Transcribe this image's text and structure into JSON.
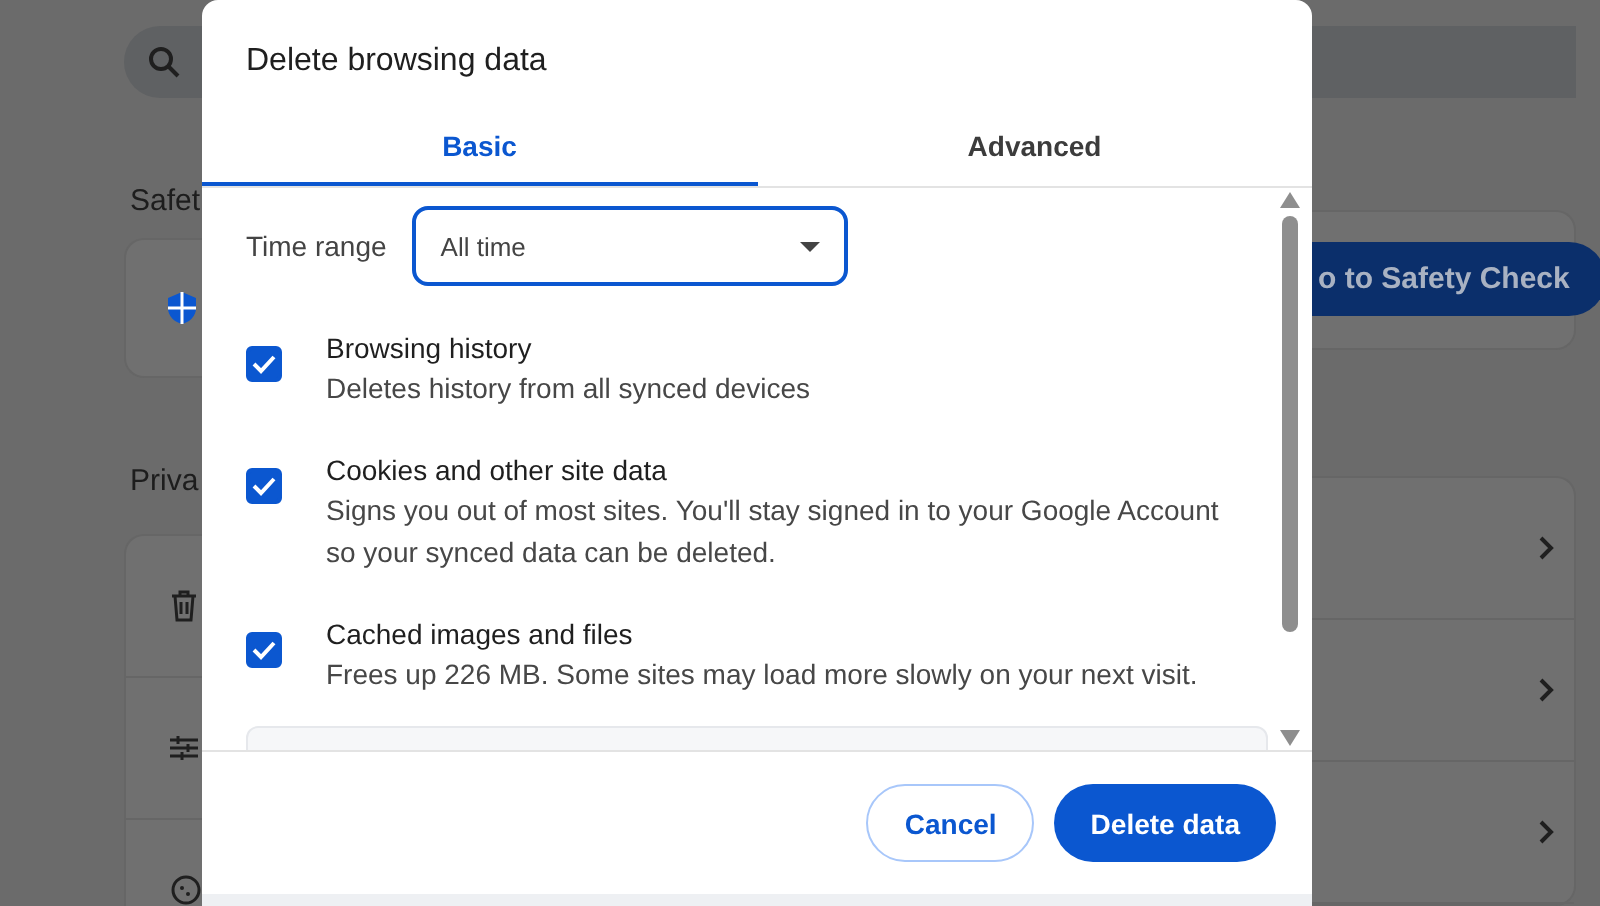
{
  "page": {
    "sections": [
      {
        "kind": "safety",
        "heading": "Safet",
        "button": "o to Safety Check"
      },
      {
        "kind": "privacy",
        "heading": "Priva",
        "rows": [
          {
            "kind": "trash"
          },
          {
            "kind": "tune"
          },
          {
            "kind": "cookie"
          }
        ]
      }
    ]
  },
  "dialog": {
    "title": "Delete browsing data",
    "tabs": [
      {
        "label": "Basic",
        "selected": true
      },
      {
        "label": "Advanced",
        "selected": false
      }
    ],
    "time_range": {
      "label": "Time range",
      "value": "All time"
    },
    "options": [
      {
        "title": "Browsing history",
        "description": "Deletes history from all synced devices",
        "checked": true
      },
      {
        "title": "Cookies and other site data",
        "description": "Signs you out of most sites. You'll stay signed in to your Google Account so your synced data can be deleted.",
        "checked": true
      },
      {
        "title": "Cached images and files",
        "description": "Frees up 226 MB. Some sites may load more slowly on your next visit.",
        "checked": true
      }
    ],
    "buttons": [
      {
        "label": "Cancel",
        "kind": "secondary"
      },
      {
        "label": "Delete data",
        "kind": "primary"
      }
    ]
  }
}
